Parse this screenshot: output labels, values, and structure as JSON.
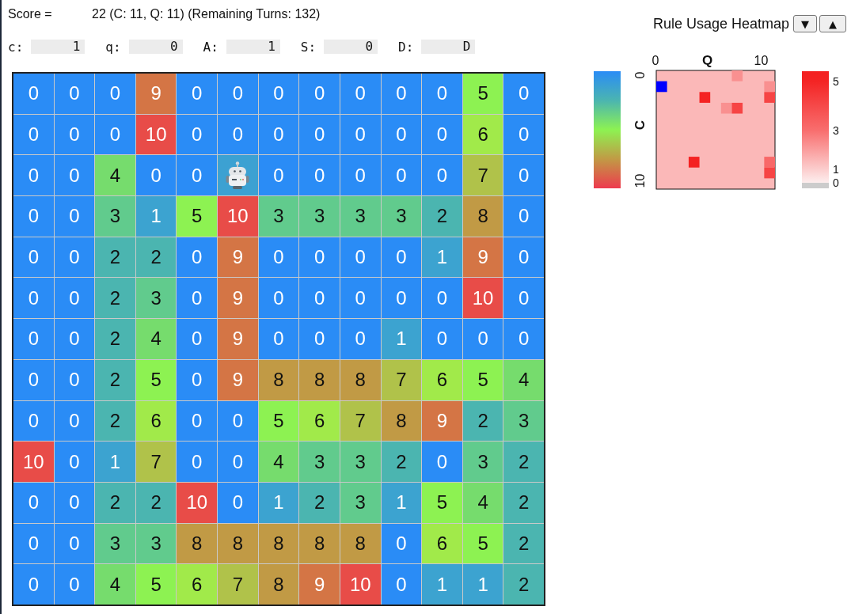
{
  "score": {
    "label": "Score =",
    "value": "22 (C: 11, Q: 11) (Remaining Turns: 132)"
  },
  "fields": [
    {
      "label": "c:",
      "value": "1"
    },
    {
      "label": "q:",
      "value": "0"
    },
    {
      "label": "A:",
      "value": "1"
    },
    {
      "label": "S:",
      "value": "0"
    },
    {
      "label": "D:",
      "value": "D"
    }
  ],
  "grid": {
    "rows": [
      [
        "0",
        "0",
        "0",
        "9",
        "0",
        "0",
        "0",
        "0",
        "0",
        "0",
        "0",
        "5",
        "0"
      ],
      [
        "0",
        "0",
        "0",
        "10",
        "0",
        "0",
        "0",
        "0",
        "0",
        "0",
        "0",
        "6",
        "0"
      ],
      [
        "0",
        "0",
        "4",
        "0",
        "0",
        {
          "kind": "robot"
        },
        "0",
        "0",
        "0",
        "0",
        "0",
        "7",
        "0"
      ],
      [
        "0",
        "0",
        "3",
        "1",
        "5",
        "10",
        "3",
        "3",
        "3",
        "3",
        "2",
        "8",
        "0"
      ],
      [
        "0",
        "0",
        "2",
        "2",
        "0",
        "9",
        "0",
        "0",
        "0",
        "0",
        "1",
        "9",
        "0"
      ],
      [
        "0",
        "0",
        "2",
        "3",
        "0",
        "9",
        "0",
        "0",
        "0",
        "0",
        "0",
        "10",
        "0"
      ],
      [
        "0",
        "0",
        "2",
        "4",
        "0",
        "9",
        "0",
        "0",
        "0",
        "1",
        "0",
        "0",
        "0"
      ],
      [
        "0",
        "0",
        "2",
        "5",
        "0",
        "9",
        "8",
        "8",
        "8",
        "7",
        "6",
        "5",
        "4"
      ],
      [
        "0",
        "0",
        "2",
        "6",
        "0",
        "0",
        "5",
        "6",
        "7",
        "8",
        "9",
        "2",
        "3"
      ],
      [
        "10",
        "0",
        "1",
        "7",
        "0",
        "0",
        "4",
        "3",
        "3",
        "2",
        "0",
        "3",
        "2"
      ],
      [
        "0",
        "0",
        "2",
        "2",
        "10",
        "0",
        "1",
        "2",
        "3",
        "1",
        "5",
        "4",
        "2"
      ],
      [
        "0",
        "0",
        "3",
        "3",
        "8",
        "8",
        "8",
        "8",
        "8",
        "0",
        "6",
        "5",
        "2"
      ],
      [
        "0",
        "0",
        "4",
        "5",
        "6",
        "7",
        "8",
        "9",
        "10",
        "0",
        "1",
        "1",
        "2"
      ]
    ]
  },
  "heatmap_panel": {
    "title": "Rule Usage Heatmap",
    "buttons": [
      "▼",
      "▲"
    ],
    "heatmap": {
      "x_title": "Q",
      "x_ticks": [
        "0",
        "10"
      ],
      "y_title": "C",
      "y_ticks": [
        "0",
        "10"
      ],
      "scale_labels": [
        "5",
        "3",
        "1",
        "0"
      ]
    }
  }
}
